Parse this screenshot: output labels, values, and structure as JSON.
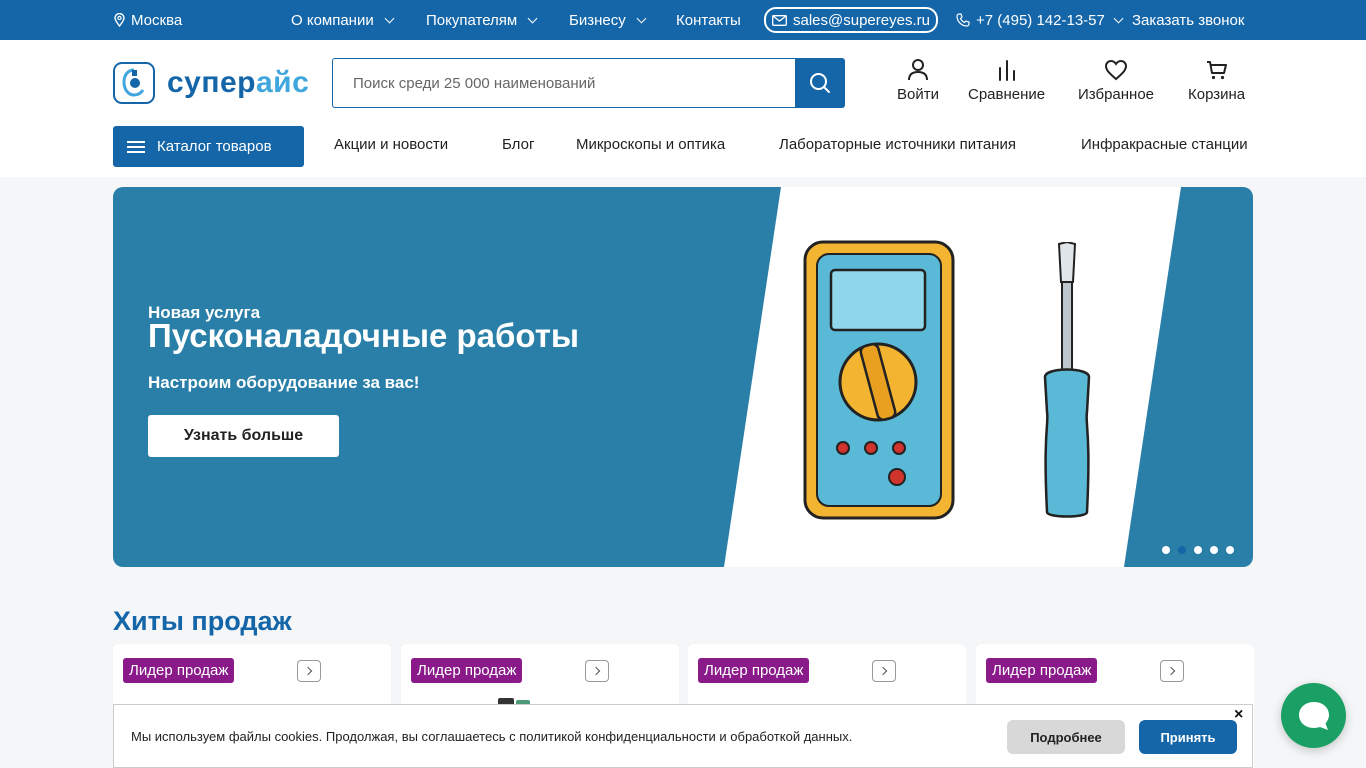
{
  "topbar": {
    "city": "Москва",
    "menu": [
      {
        "label": "О компании"
      },
      {
        "label": "Покупателям"
      },
      {
        "label": "Бизнесу"
      }
    ],
    "contacts": "Контакты",
    "email": "sales@supereyes.ru",
    "phone": "+7 (495) 142-13-57",
    "callback": "Заказать звонок"
  },
  "header": {
    "logo_part1": "супер",
    "logo_part2": "айс",
    "search_placeholder": "Поиск среди 25 000 наименований",
    "search_value": "",
    "actions": {
      "login": "Войти",
      "compare": "Сравнение",
      "favorites": "Избранное",
      "cart": "Корзина"
    },
    "catalog_label": "Каталог товаров",
    "nav": [
      "Акции и новости",
      "Блог",
      "Микроскопы и оптика",
      "Лабораторные источники питания",
      "Инфракрасные станции"
    ]
  },
  "banner": {
    "subtitle": "Новая услуга",
    "title": "Пусконаладочные работы",
    "tagline": "Настроим оборудование за вас!",
    "button": "Узнать больше",
    "slides_total": 5,
    "active_slide": 2
  },
  "hits": {
    "title": "Хиты продаж",
    "badges": [
      "Лидер продаж",
      "Лидер продаж",
      "Лидер продаж",
      "Лидер продаж"
    ]
  },
  "cookie": {
    "text": "Мы используем файлы cookies. Продолжая, вы соглашаетесь с политикой конфиденциальности и обработкой данных.",
    "more": "Подробнее",
    "accept": "Принять",
    "close": "×"
  },
  "colors": {
    "brand": "#1466a8",
    "banner": "#2a7fa8",
    "badge": "#8a1a8a",
    "chat": "#1aa064"
  }
}
